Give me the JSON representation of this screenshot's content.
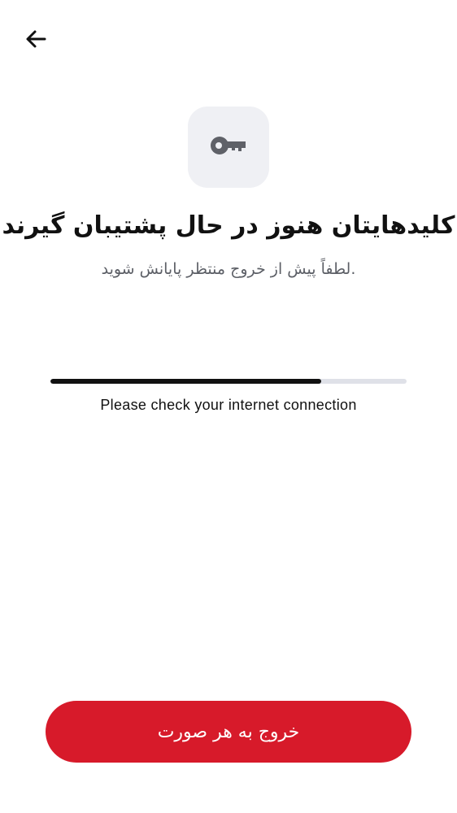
{
  "header": {
    "back_icon": "arrow-left-icon"
  },
  "illustration": {
    "icon": "key-icon",
    "tile_color": "#eff0f4",
    "icon_color": "#5f6168"
  },
  "main": {
    "title": "کلیدهایتان هنوز در حال پشتیبان گیرند",
    "subtitle": "لطفاً پیش از خروج منتظر پایانش شوید.",
    "progress_percent": 76,
    "status_text": "Please check your internet connection"
  },
  "footer": {
    "exit_label": "خروج به هر صورت",
    "accent_color": "#d71a2a"
  }
}
